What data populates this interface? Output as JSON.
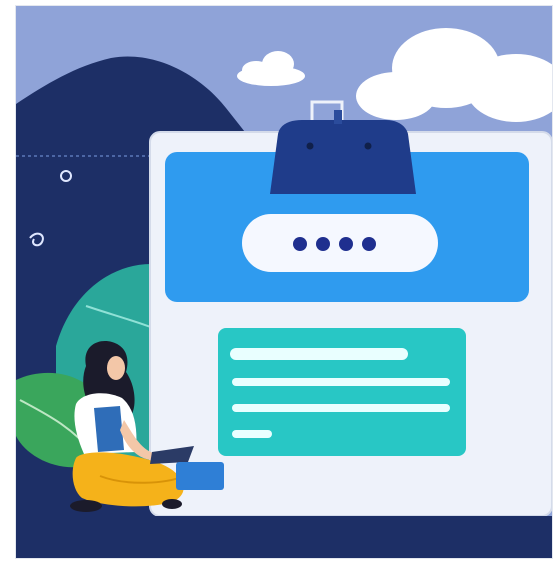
{
  "illustration": {
    "kind": "login illustration",
    "password_mask": "••••",
    "colors": {
      "sky": "#8fa3d8",
      "navy": "#1d2f66",
      "card": "#eef2fa",
      "header_blue": "#2f9bef",
      "pill": "#f5f8ff",
      "dots": "#1f2f8f",
      "teal_panel": "#28c7c5",
      "lines": "#e9ffff",
      "leaf_green": "#3aa65c",
      "leaf_teal": "#2aa79a",
      "skin": "#f3c7a8",
      "hair": "#1b1b2b",
      "shirt": "#ffffff",
      "pants": "#f5b21a"
    }
  }
}
